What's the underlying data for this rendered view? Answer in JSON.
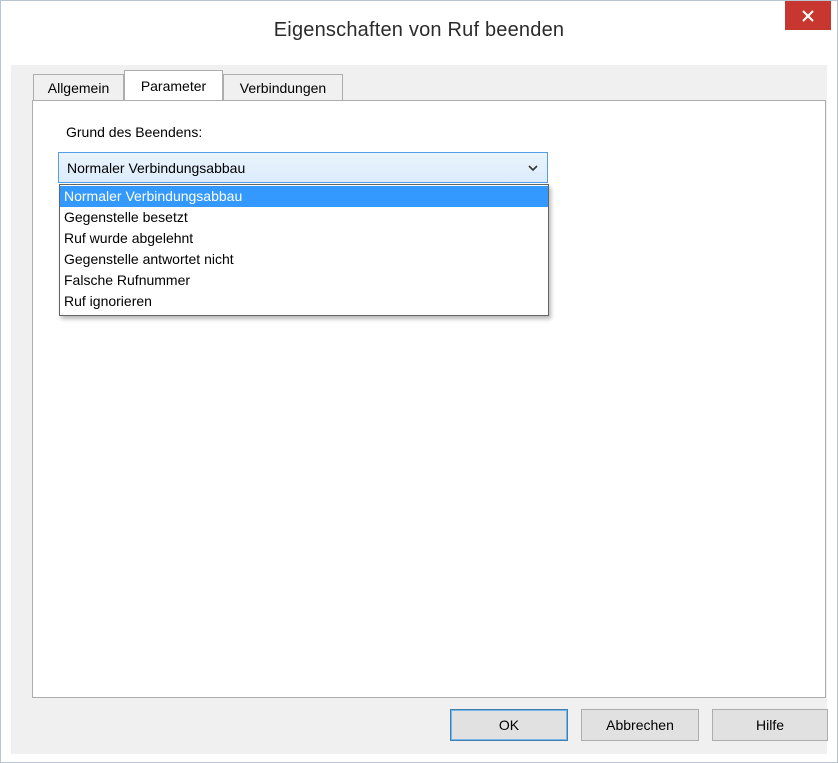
{
  "window": {
    "title": "Eigenschaften von Ruf beenden",
    "close_icon": "close-icon",
    "close_color": "#c7372f"
  },
  "tabs": [
    {
      "label": "Allgemein",
      "active": false
    },
    {
      "label": "Parameter",
      "active": true
    },
    {
      "label": "Verbindungen",
      "active": false
    }
  ],
  "parameter": {
    "field_label": "Grund des Beendens:",
    "selected_value": "Normaler Verbindungsabbau",
    "dropdown_icon": "chevron-down-icon",
    "options": [
      "Normaler Verbindungsabbau",
      "Gegenstelle besetzt",
      "Ruf wurde abgelehnt",
      "Gegenstelle antwortet nicht",
      "Falsche Rufnummer",
      "Ruf ignorieren"
    ],
    "highlight_color": "#3399ff"
  },
  "buttons": {
    "ok": "OK",
    "cancel": "Abbrechen",
    "help": "Hilfe"
  }
}
